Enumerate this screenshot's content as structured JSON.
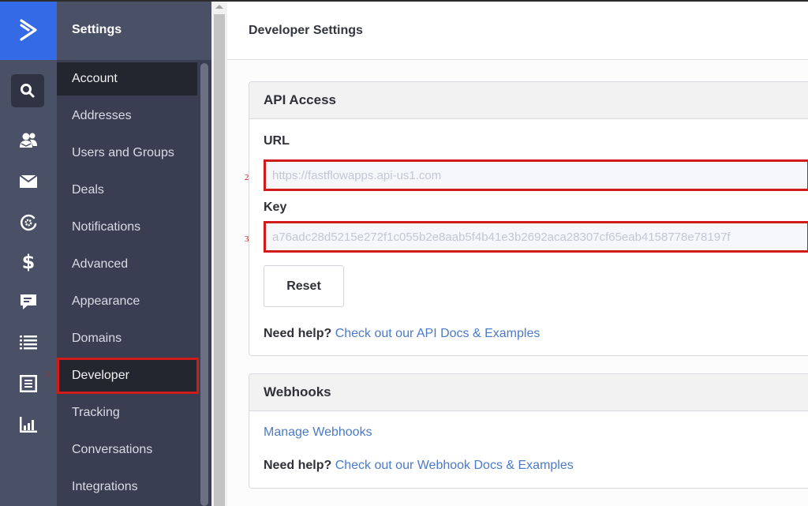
{
  "rail": {
    "logo_icon": "activecampaign-chevron-logo",
    "icons": [
      "search-icon",
      "contacts-icon",
      "campaigns-mail-icon",
      "automations-icon",
      "deals-dollar-icon",
      "conversations-chat-icon",
      "lists-icon",
      "forms-icon",
      "reports-chart-icon"
    ]
  },
  "nav": {
    "title": "Settings",
    "items": [
      {
        "label": "Account"
      },
      {
        "label": "Addresses"
      },
      {
        "label": "Users and Groups"
      },
      {
        "label": "Deals"
      },
      {
        "label": "Notifications"
      },
      {
        "label": "Advanced"
      },
      {
        "label": "Appearance"
      },
      {
        "label": "Domains"
      },
      {
        "label": "Developer"
      },
      {
        "label": "Tracking"
      },
      {
        "label": "Conversations"
      },
      {
        "label": "Integrations"
      }
    ],
    "active_item": "Account",
    "highlighted_item": "Developer"
  },
  "annotations": {
    "m1": "1",
    "m2": "2",
    "m3": "3"
  },
  "page": {
    "title": "Developer Settings",
    "api_access": {
      "heading": "API Access",
      "url_label": "URL",
      "url_value": "https://fastflowapps.api-us1.com",
      "key_label": "Key",
      "key_value": "a76adc28d5215e272f1c055b2e8aab5f4b41e3b2692aca28307cf65eab4158778e78197f",
      "reset_label": "Reset",
      "help_prefix": "Need help?",
      "help_link": "Check out our API Docs & Examples"
    },
    "webhooks": {
      "heading": "Webhooks",
      "manage_link": "Manage Webhooks",
      "help_prefix": "Need help?",
      "help_link": "Check out our Webhook Docs & Examples"
    }
  },
  "colors": {
    "brand_blue": "#356ae6",
    "annotation_red": "#d11a1a",
    "link_blue": "#4a7ac9"
  }
}
